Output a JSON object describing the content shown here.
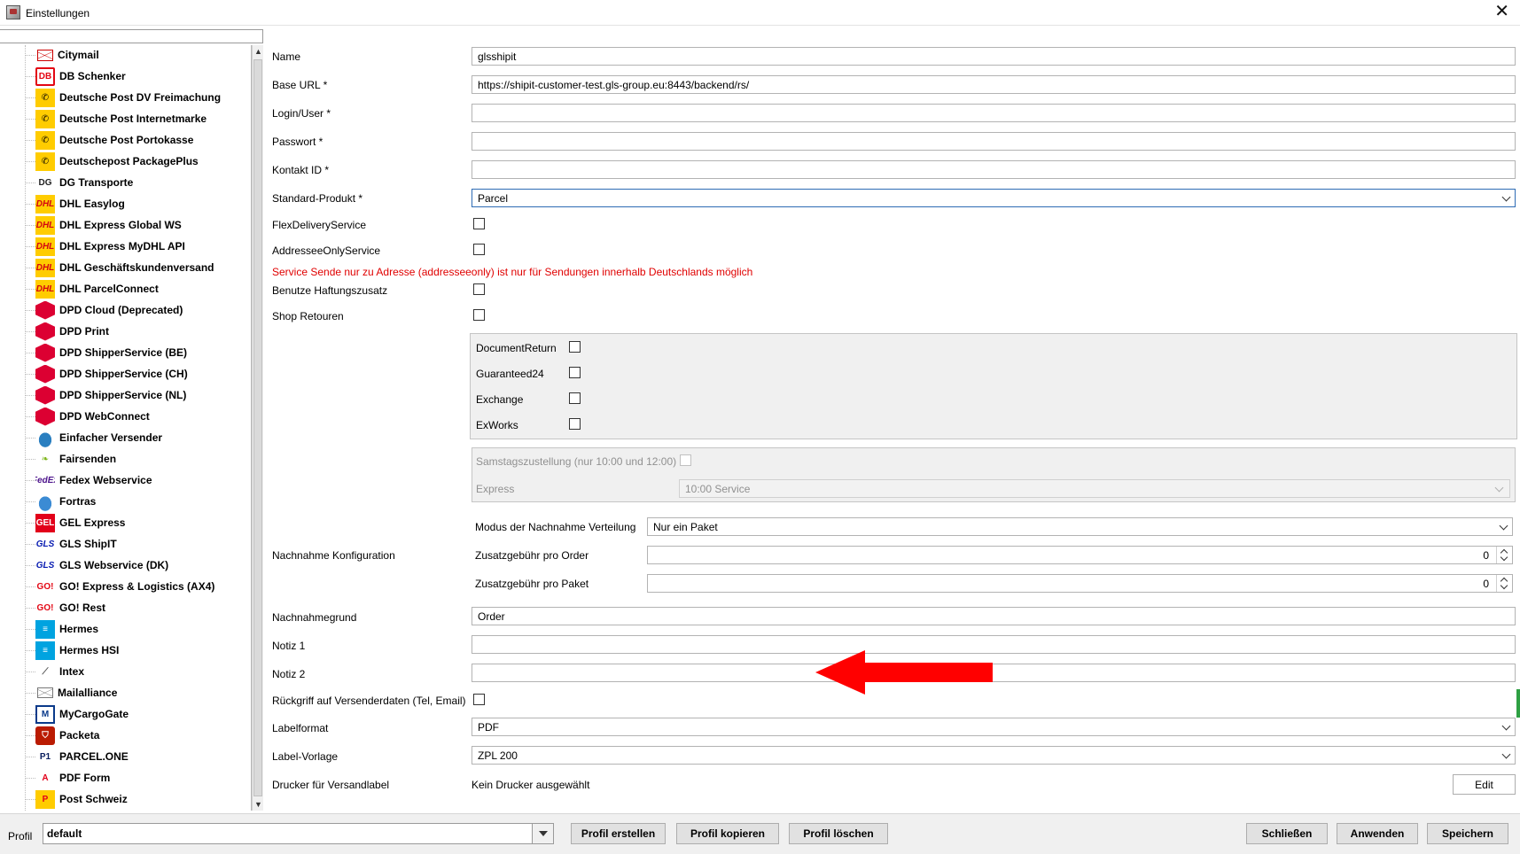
{
  "window": {
    "title": "Einstellungen",
    "close_glyph": "✕"
  },
  "tree": {
    "items": [
      {
        "label": "Citymail",
        "icon": "mail-icon",
        "icon_text": ""
      },
      {
        "label": "DB Schenker",
        "icon": "db-logo-icon",
        "icon_text": "DB"
      },
      {
        "label": "Deutsche Post DV Freimachung",
        "icon": "posthorn-icon",
        "icon_text": "✆"
      },
      {
        "label": "Deutsche Post Internetmarke",
        "icon": "posthorn-icon",
        "icon_text": "✆"
      },
      {
        "label": "Deutsche Post Portokasse",
        "icon": "posthorn-icon",
        "icon_text": "✆"
      },
      {
        "label": "Deutschepost PackagePlus",
        "icon": "posthorn-icon",
        "icon_text": "✆"
      },
      {
        "label": "DG Transporte",
        "icon": "dg-logo-icon",
        "icon_text": "DG"
      },
      {
        "label": "DHL Easylog",
        "icon": "dhl-logo-icon",
        "icon_text": "DHL"
      },
      {
        "label": "DHL Express Global WS",
        "icon": "dhl-logo-icon",
        "icon_text": "DHL"
      },
      {
        "label": "DHL Express MyDHL API",
        "icon": "dhl-logo-icon",
        "icon_text": "DHL"
      },
      {
        "label": "DHL Geschäftskundenversand",
        "icon": "dhl-logo-icon",
        "icon_text": "DHL"
      },
      {
        "label": "DHL ParcelConnect",
        "icon": "dhl-logo-icon",
        "icon_text": "DHL"
      },
      {
        "label": "DPD Cloud (Deprecated)",
        "icon": "dpd-cube-icon",
        "icon_text": ""
      },
      {
        "label": "DPD Print",
        "icon": "dpd-cube-icon",
        "icon_text": ""
      },
      {
        "label": "DPD ShipperService (BE)",
        "icon": "dpd-cube-icon",
        "icon_text": ""
      },
      {
        "label": "DPD ShipperService (CH)",
        "icon": "dpd-cube-icon",
        "icon_text": ""
      },
      {
        "label": "DPD ShipperService (NL)",
        "icon": "dpd-cube-icon",
        "icon_text": ""
      },
      {
        "label": "DPD WebConnect",
        "icon": "dpd-cube-icon",
        "icon_text": ""
      },
      {
        "label": "Einfacher Versender",
        "icon": "cloud-icon",
        "icon_text": ""
      },
      {
        "label": "Fairsenden",
        "icon": "leaf-icon",
        "icon_text": "❧"
      },
      {
        "label": "Fedex Webservice",
        "icon": "fedex-logo-icon",
        "icon_text": "FedEx"
      },
      {
        "label": "Fortras",
        "icon": "cloud-icon",
        "icon_text": ""
      },
      {
        "label": "GEL Express",
        "icon": "gel-logo-icon",
        "icon_text": "GEL"
      },
      {
        "label": "GLS ShipIT",
        "icon": "gls-logo-icon",
        "icon_text": "GLS"
      },
      {
        "label": "GLS Webservice (DK)",
        "icon": "gls-logo-icon",
        "icon_text": "GLS"
      },
      {
        "label": "GO! Express & Logistics (AX4)",
        "icon": "go-logo-icon",
        "icon_text": "GO!"
      },
      {
        "label": "GO! Rest",
        "icon": "go-logo-icon",
        "icon_text": "GO!"
      },
      {
        "label": "Hermes",
        "icon": "hermes-logo-icon",
        "icon_text": "≡"
      },
      {
        "label": "Hermes HSI",
        "icon": "hermes-logo-icon",
        "icon_text": "≡"
      },
      {
        "label": "Intex",
        "icon": "intex-logo-icon",
        "icon_text": "⟋"
      },
      {
        "label": "Mailalliance",
        "icon": "mail-icon",
        "icon_text": ""
      },
      {
        "label": "MyCargoGate",
        "icon": "mycargogate-logo-icon",
        "icon_text": "M"
      },
      {
        "label": "Packeta",
        "icon": "packeta-logo-icon",
        "icon_text": "⛉"
      },
      {
        "label": "PARCEL.ONE",
        "icon": "parcelone-logo-icon",
        "icon_text": "P1"
      },
      {
        "label": "PDF Form",
        "icon": "pdf-icon",
        "icon_text": "A"
      },
      {
        "label": "Post Schweiz",
        "icon": "post-ch-logo-icon",
        "icon_text": "P"
      }
    ]
  },
  "form": {
    "name_label": "Name",
    "name_value": "glsshipit",
    "baseurl_label": "Base URL *",
    "baseurl_value": "https://shipit-customer-test.gls-group.eu:8443/backend/rs/",
    "login_label": "Login/User *",
    "login_value": "",
    "password_label": "Passwort *",
    "password_value": "",
    "contact_label": "Kontakt ID *",
    "contact_value": "",
    "product_label": "Standard-Produkt *",
    "product_value": "Parcel",
    "flex_label": "FlexDeliveryService",
    "addressee_label": "AddresseeOnlyService",
    "warning_text": "Service Sende nur zu Adresse (addresseeonly) ist nur für Sendungen innerhalb Deutschlands möglich",
    "liability_label": "Benutze Haftungszusatz",
    "shopreturn_label": "Shop Retouren",
    "docreturn_label": "DocumentReturn",
    "guaranteed_label": "Guaranteed24",
    "exchange_label": "Exchange",
    "exworks_label": "ExWorks",
    "saturday_label": "Samstagszustellung (nur 10:00 und 12:00)",
    "express_label": "Express",
    "express_value": "10:00 Service",
    "cod_config_label": "Nachnahme Konfiguration",
    "cod_mode_label": "Modus der Nachnahme Verteilung",
    "cod_mode_value": "Nur ein Paket",
    "fee_order_label": "Zusatzgebühr pro Order",
    "fee_order_value": "0",
    "fee_parcel_label": "Zusatzgebühr pro Paket",
    "fee_parcel_value": "0",
    "cod_reason_label": "Nachnahmegrund",
    "cod_reason_value": "Order",
    "note1_label": "Notiz 1",
    "note1_value": "",
    "note2_label": "Notiz 2",
    "note2_value": "",
    "fallback_label": "Rückgriff auf Versenderdaten (Tel, Email)",
    "labelformat_label": "Labelformat",
    "labelformat_value": "PDF",
    "labeltemplate_label": "Label-Vorlage",
    "labeltemplate_value": "ZPL 200",
    "printer_label": "Drucker für Versandlabel",
    "printer_value": "Kein Drucker ausgewählt",
    "edit_button": "Edit"
  },
  "bottom": {
    "profile_label": "Profil",
    "profile_value": "default",
    "create_button": "Profil erstellen",
    "copy_button": "Profil kopieren",
    "delete_button": "Profil löschen",
    "close_button": "Schließen",
    "apply_button": "Anwenden",
    "save_button": "Speichern"
  },
  "colors": {
    "accent": "#2d6bb4",
    "warning": "#e00000",
    "annotation_arrow": "#ff0000"
  }
}
